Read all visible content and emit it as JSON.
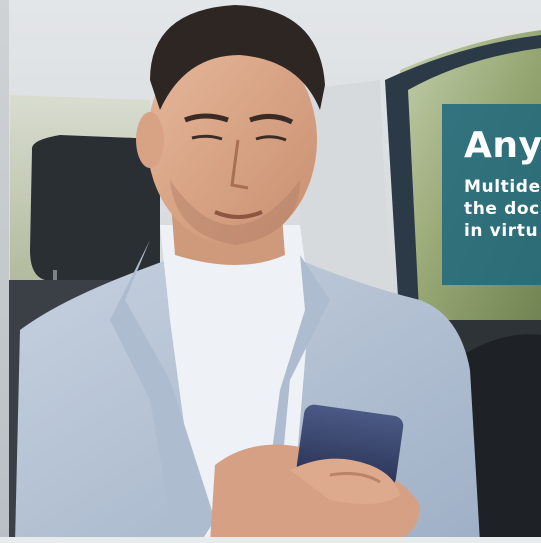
{
  "overlay": {
    "headline": "Any",
    "lines": [
      "Multide",
      "the doc",
      "in virtu"
    ]
  },
  "colors": {
    "overlay_bg": "#1f687d",
    "overlay_text": "#ffffff",
    "jacket": "#b7c4d6",
    "shirt": "#eef2f7",
    "seat": "#2a2f34",
    "window_green": "#8fa06c"
  },
  "scene": {
    "subject": "man in light blue blazer looking at smartphone in car back seat"
  }
}
